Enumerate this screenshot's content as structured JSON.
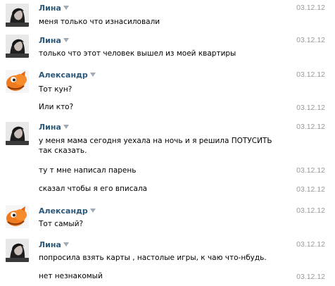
{
  "messages": [
    {
      "sender": "Лина",
      "text": "меня только что изнасиловали",
      "date": "03.12.12"
    },
    {
      "sender": "Лина",
      "text": "только что этот человек вышел из моей квартиры",
      "date": "03.12.12"
    },
    {
      "sender": "Александр",
      "text": "Тот кун?",
      "date": "03.12.12"
    },
    {
      "text": "Или кто?",
      "date": "03.12.12"
    },
    {
      "sender": "Лина",
      "text": "у меня мама сегодня уехала на ночь и я решила ПОТУСИТЬ так сказать.",
      "date": "03.12.12"
    },
    {
      "text": "ту т мне написал парень",
      "date": "03.12.12"
    },
    {
      "text": "сказал чтобы я его вписала",
      "date": "03.12.12"
    },
    {
      "sender": "Александр",
      "text": "Тот самый?",
      "date": "03.12.12"
    },
    {
      "sender": "Лина",
      "text": "попросила взять карты , настолые игры, к чаю что-нбудь.",
      "date": "03.12.12"
    },
    {
      "text": "нет незнакомый",
      "date": "03.12.12"
    }
  ],
  "icons": {
    "sender_menu": "chevron-down-icon",
    "lina_avatar": "user-photo-lina",
    "alexandr_avatar": "user-photo-orange-character"
  },
  "colors": {
    "sender_name": "#2b587a",
    "date": "#999999",
    "text": "#000000",
    "chevron": "#a0a9b5"
  }
}
